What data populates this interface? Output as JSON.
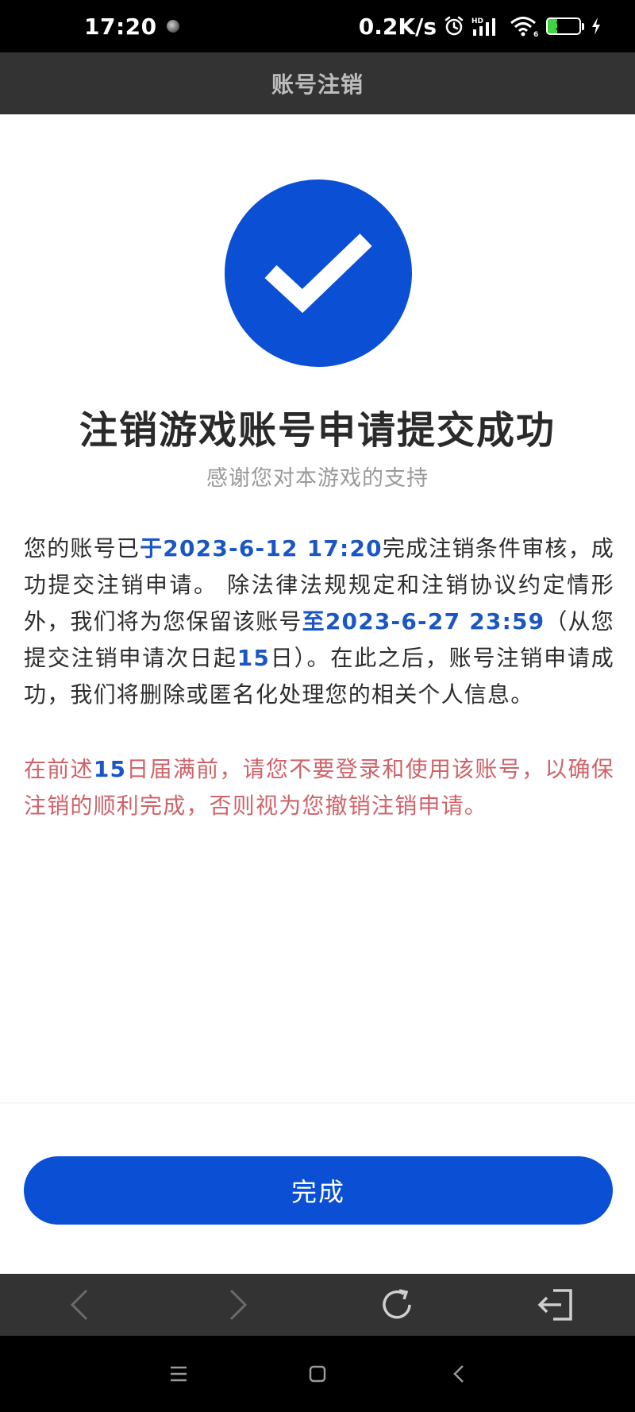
{
  "status_bar": {
    "time": "17:20",
    "network_speed": "0.2K/s",
    "signal_label": "HD",
    "wifi_label": "6",
    "battery_level": "30",
    "battery_fraction": 0.3,
    "battery_color": "#3ed63e"
  },
  "header": {
    "title": "账号注销"
  },
  "result": {
    "icon": "checkmark-icon",
    "accent_color": "#0a4fd4",
    "title": "注销游戏账号申请提交成功",
    "subtitle": "感谢您对本游戏的支持"
  },
  "details": {
    "p1_seg1": "您的账号已",
    "p1_hl1": "于2023-6-12 17:20",
    "p1_seg2": "完成注销条件审核，成功提交注销申请。 除法律法规规定和注销协议约定情形外，我们将为您保留该账号",
    "p1_hl2": "至2023-6-27 23:59",
    "p1_seg3": "（从您提交注销申请次日起",
    "p1_hl3": "15",
    "p1_seg4": "日）。在此之后，账号注销申请成功，我们将删除或匿名化处理您的相关个人信息。",
    "warn_seg1": "在前述",
    "warn_hl": "15",
    "warn_seg2": "日届满前，请您不要登录和使用该账号，以确保注销的顺利完成，否则视为您撤销注销申请。",
    "highlight_color": "#1a56c4",
    "warning_color": "#d0636a"
  },
  "actions": {
    "done_label": "完成"
  },
  "browser_toolbar": {
    "icons": [
      "back-icon",
      "forward-icon",
      "refresh-icon",
      "exit-icon"
    ]
  },
  "system_nav": {
    "icons": [
      "menu-icon",
      "home-icon",
      "back-icon"
    ]
  }
}
